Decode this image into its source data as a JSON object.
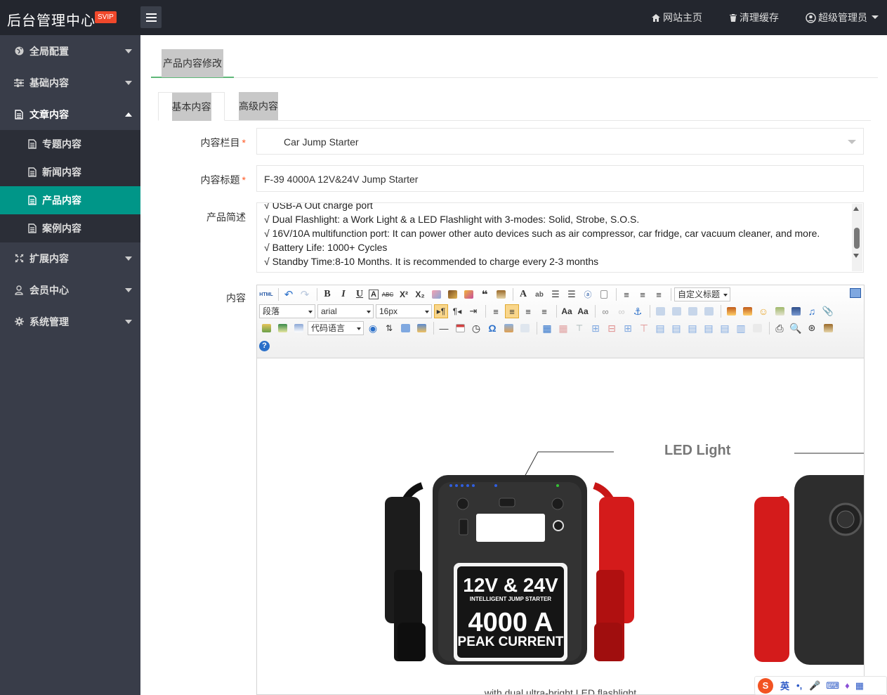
{
  "header": {
    "brand": "后台管理中心",
    "badge": "SVIP",
    "links": [
      {
        "label": "网站主页",
        "icon": "home-icon"
      },
      {
        "label": "清理缓存",
        "icon": "trash-icon"
      },
      {
        "label": "超级管理员",
        "icon": "user-icon"
      }
    ]
  },
  "sidebar": {
    "items": [
      {
        "label": "全局配置",
        "icon": "globe-icon"
      },
      {
        "label": "基础内容",
        "icon": "sliders-icon"
      },
      {
        "label": "文章内容",
        "icon": "file-icon",
        "expanded": true
      },
      {
        "label": "扩展内容",
        "icon": "expand-icon"
      },
      {
        "label": "会员中心",
        "icon": "user-icon"
      },
      {
        "label": "系统管理",
        "icon": "gear-icon"
      }
    ],
    "subitems": [
      {
        "label": "专题内容"
      },
      {
        "label": "新闻内容"
      },
      {
        "label": "产品内容",
        "active": true
      },
      {
        "label": "案例内容"
      }
    ]
  },
  "page": {
    "tab_title": "产品内容修改",
    "tabs": [
      "基本内容",
      "高级内容"
    ]
  },
  "form": {
    "category_label": "内容栏目",
    "category_value": "Car Jump Starter",
    "title_label": "内容标题",
    "title_value": "F-39 4000A 12V&24V Jump Starter",
    "desc_label": "产品简述",
    "desc_lines": [
      "√ USB-A Out charge port",
      "√ Dual Flashlight: a Work Light & a LED Flashlight with 3-modes: Solid, Strobe, S.O.S.",
      "√ 16V/10A multifunction port: It can power other auto devices such as air compressor, car fridge, car vacuum cleaner, and more.",
      "√ Battery Life: 1000+ Cycles",
      "√ Standby Time:8-10 Months. It is recommended to charge every 2-3 months"
    ],
    "content_label": "内容"
  },
  "editor": {
    "paragraph": "段落",
    "font": "arial",
    "size": "16px",
    "code_lang": "代码语言",
    "custom_title": "自定义标题",
    "image_text": {
      "led": "LED Light",
      "l1": "12V & 24V",
      "l2": "INTELLIGENT JUMP STARTER",
      "l3": "4000 A",
      "l4": "PEAK CURRENT",
      "caption": "with dual ultra-bright LED flashlight"
    }
  },
  "ime": {
    "lang": "英"
  }
}
